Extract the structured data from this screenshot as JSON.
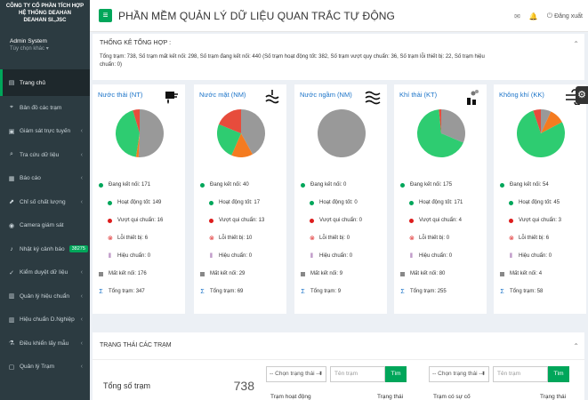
{
  "sidebar": {
    "company_line1": "CÔNG TY CỔ PHẦN TÍCH HỢP",
    "company_line2": "HỆ THỐNG DEAHAN",
    "company_line3": "DEAHAN SI.,JSC",
    "user_name": "Admin System",
    "user_option": "Tùy chọn khác ▾",
    "items": [
      {
        "label": "Trang chủ",
        "icon": "dashboard-icon"
      },
      {
        "label": "Bản đồ các trạm",
        "icon": "map-icon"
      },
      {
        "label": "Giám sát trực tuyến",
        "icon": "monitor-icon"
      },
      {
        "label": "Tra cứu dữ liệu",
        "icon": "search-icon"
      },
      {
        "label": "Báo cáo",
        "icon": "report-icon"
      },
      {
        "label": "Chỉ số chất lượng",
        "icon": "chart-icon"
      },
      {
        "label": "Camera giám sát",
        "icon": "camera-icon"
      },
      {
        "label": "Nhật ký cảnh báo",
        "icon": "bell-icon",
        "badge": "38275"
      },
      {
        "label": "Kiểm duyệt dữ liệu",
        "icon": "check-icon"
      },
      {
        "label": "Quản lý hiệu chuẩn",
        "icon": "calibrate-icon"
      },
      {
        "label": "Hiệu chuẩn D.Nghiệp",
        "icon": "calibrate-icon"
      },
      {
        "label": "Điều khiển lấy mẫu",
        "icon": "sample-icon"
      },
      {
        "label": "Quản lý Trạm",
        "icon": "station-icon"
      }
    ]
  },
  "header": {
    "title": "PHẦN MỀM QUẢN LÝ DỮ LIỆU QUAN TRẮC TỰ ĐỘNG",
    "logout": "Đăng xuất"
  },
  "summary": {
    "title": "THỐNG KÊ TỔNG HỢP :",
    "text": "Tổng trạm: 738, Số trạm mất kết nối: 298, Số trạm đang kết nối: 440 (Số trạm hoạt động tốt: 382, Số trạm vượt quy chuẩn: 36, Số trạm lỗi thiết bị: 22, Số trạm hiệu chuẩn: 0)"
  },
  "colors": {
    "good": "#2ecc71",
    "exceed": "#e74c3c",
    "error": "#f47b20",
    "calib": "#9b59b6",
    "lost": "#999999",
    "brand": "#00a65a"
  },
  "labels": {
    "connecting": "Đang kết nối:",
    "good": "Hoạt động tốt:",
    "exceed": "Vượt qui chuẩn:",
    "error": "Lỗi thiết bị:",
    "calib": "Hiệu chuẩn:",
    "lost": "Mất kết nối:",
    "total": "Tổng trạm:"
  },
  "cards": [
    {
      "title": "Nước thải (NT)",
      "icon": "wastewater-icon",
      "connecting": 171,
      "good": 149,
      "exceed": 16,
      "error": 6,
      "calib": 0,
      "lost": 176,
      "total": 347
    },
    {
      "title": "Nước mặt (NM)",
      "icon": "surface-water-icon",
      "connecting": 40,
      "good": 17,
      "exceed": 13,
      "error": 10,
      "calib": 0,
      "lost": 29,
      "total": 69
    },
    {
      "title": "Nước ngầm (NM)",
      "icon": "groundwater-icon",
      "connecting": 0,
      "good": 0,
      "exceed": 0,
      "error": 0,
      "calib": 0,
      "lost": 9,
      "total": 9
    },
    {
      "title": "Khí thải (KT)",
      "icon": "emission-icon",
      "connecting": 175,
      "good": 171,
      "exceed": 4,
      "error": 0,
      "calib": 0,
      "lost": 80,
      "total": 255
    },
    {
      "title": "Không khí (KK)",
      "icon": "air-icon",
      "connecting": 54,
      "good": 45,
      "exceed": 3,
      "error": 6,
      "calib": 0,
      "lost": 4,
      "total": 58
    }
  ],
  "status": {
    "title": "TRẠNG THÁI CÁC TRẠM",
    "total_label": "Tổng số trạm",
    "total_value": "738",
    "select_placeholder": "-- Chọn trạng thái --",
    "search_placeholder": "Tên trạm",
    "search_button": "Tìm",
    "table_left_col1": "Trạm hoạt động",
    "table_left_col2": "Trạng thái",
    "table_right_col1": "Trạm có sự cố",
    "table_right_col2": "Trạng thái"
  }
}
